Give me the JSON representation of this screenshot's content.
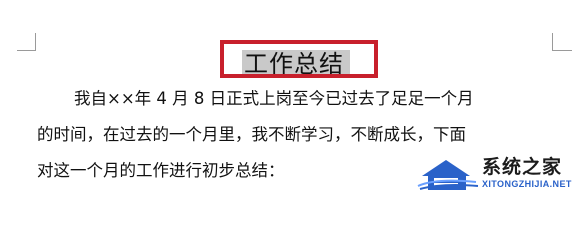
{
  "document": {
    "title": "工作总结",
    "paragraph_lines": [
      "我自××年 4 月 8 日正式上岗至今已过去了足足一个月",
      "的时间，在过去的一个月里，我不断学习，不断成长，下面",
      "对这一个月的工作进行初步总结："
    ]
  },
  "watermark": {
    "site_name": "系统之家",
    "url": "XITONGZHIJIA.NET",
    "icon": "house-logo-icon",
    "accent_color": "#2a62c9"
  },
  "highlight_color": "#c8202c"
}
